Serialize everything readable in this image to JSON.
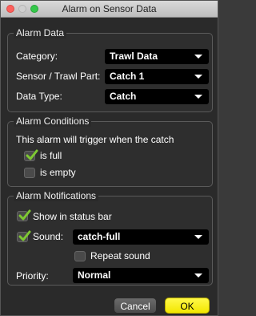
{
  "window": {
    "title": "Alarm on Sensor Data"
  },
  "alarm_data": {
    "title": "Alarm Data",
    "category_label": "Category:",
    "category_value": "Trawl Data",
    "sensor_label": "Sensor / Trawl Part:",
    "sensor_value": "Catch 1",
    "datatype_label": "Data Type:",
    "datatype_value": "Catch"
  },
  "alarm_conditions": {
    "title": "Alarm Conditions",
    "description": "This alarm will trigger when the catch",
    "is_full": {
      "label": "is full",
      "checked": true
    },
    "is_empty": {
      "label": "is empty",
      "checked": false
    }
  },
  "alarm_notifications": {
    "title": "Alarm Notifications",
    "show_status_bar": {
      "label": "Show in status bar",
      "checked": true
    },
    "sound": {
      "label": "Sound:",
      "checked": true,
      "value": "catch-full"
    },
    "repeat_sound": {
      "label": "Repeat sound",
      "checked": false
    },
    "priority_label": "Priority:",
    "priority_value": "Normal"
  },
  "buttons": {
    "cancel": "Cancel",
    "ok": "OK"
  },
  "colors": {
    "check_green": "#7ec832",
    "ok_yellow": "#f7ee1a"
  }
}
